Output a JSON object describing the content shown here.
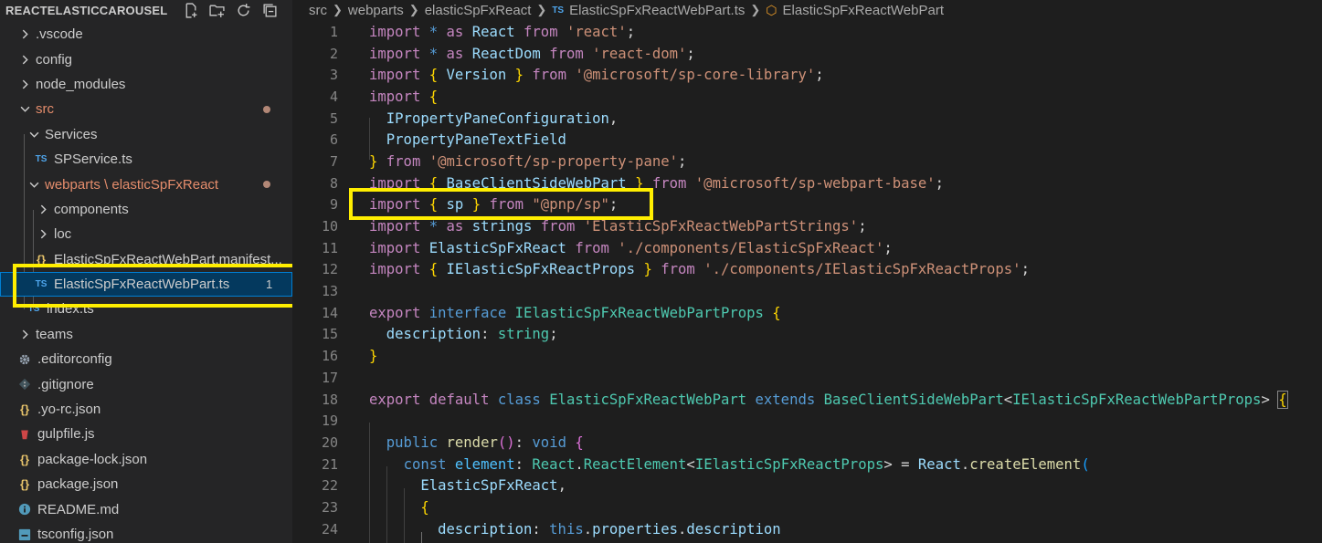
{
  "sidebar": {
    "title": "REACTELASTICCAROUSEL",
    "actions": [
      "new-file-icon",
      "new-folder-icon",
      "refresh-icon",
      "collapse-all-icon"
    ],
    "items": [
      {
        "label": ".vscode",
        "kind": "folder",
        "depth": 0,
        "open": false
      },
      {
        "label": "config",
        "kind": "folder",
        "depth": 0,
        "open": false
      },
      {
        "label": "node_modules",
        "kind": "folder",
        "depth": 0,
        "open": false
      },
      {
        "label": "src",
        "kind": "folder",
        "depth": 0,
        "open": true,
        "modified": true
      },
      {
        "label": "Services",
        "kind": "folder",
        "depth": 1,
        "open": true
      },
      {
        "label": "SPService.ts",
        "kind": "ts",
        "depth": 1
      },
      {
        "label": "webparts \\ elasticSpFxReact",
        "kind": "folder",
        "depth": 1,
        "open": true,
        "modified": true
      },
      {
        "label": "components",
        "kind": "folder",
        "depth": 2,
        "open": false
      },
      {
        "label": "loc",
        "kind": "folder",
        "depth": 2,
        "open": false
      },
      {
        "label": "ElasticSpFxReactWebPart.manifest...",
        "kind": "json",
        "depth": 2
      },
      {
        "label": "ElasticSpFxReactWebPart.ts",
        "kind": "ts",
        "depth": 2,
        "selected": true,
        "badge": "1"
      },
      {
        "label": "index.ts",
        "kind": "ts",
        "depth": 1
      },
      {
        "label": "teams",
        "kind": "folder",
        "depth": 0,
        "open": false
      },
      {
        "label": ".editorconfig",
        "kind": "gear",
        "depth": 0
      },
      {
        "label": ".gitignore",
        "kind": "git",
        "depth": 0
      },
      {
        "label": ".yo-rc.json",
        "kind": "json",
        "depth": 0
      },
      {
        "label": "gulpfile.js",
        "kind": "gulp",
        "depth": 0
      },
      {
        "label": "package-lock.json",
        "kind": "json",
        "depth": 0
      },
      {
        "label": "package.json",
        "kind": "json",
        "depth": 0
      },
      {
        "label": "README.md",
        "kind": "info",
        "depth": 0
      },
      {
        "label": "tsconfig.json",
        "kind": "tsconfig",
        "depth": 0
      }
    ]
  },
  "breadcrumb": {
    "parts": [
      "src",
      "webparts",
      "elasticSpFxReact",
      "ElasticSpFxReactWebPart.ts",
      "ElasticSpFxReactWebPart"
    ],
    "file_icon": "TS"
  },
  "editor": {
    "line_numbers": [
      "1",
      "2",
      "3",
      "4",
      "5",
      "6",
      "7",
      "8",
      "9",
      "10",
      "11",
      "12",
      "13",
      "14",
      "15",
      "16",
      "17",
      "18",
      "19",
      "20",
      "21",
      "22",
      "23",
      "24"
    ],
    "lines": [
      "import * as React from 'react';",
      "import * as ReactDom from 'react-dom';",
      "import { Version } from '@microsoft/sp-core-library';",
      "import {",
      "  IPropertyPaneConfiguration,",
      "  PropertyPaneTextField",
      "} from '@microsoft/sp-property-pane';",
      "import { BaseClientSideWebPart } from '@microsoft/sp-webpart-base';",
      "import { sp } from \"@pnp/sp\";",
      "import * as strings from 'ElasticSpFxReactWebPartStrings';",
      "import ElasticSpFxReact from './components/ElasticSpFxReact';",
      "import { IElasticSpFxReactProps } from './components/IElasticSpFxReactProps';",
      "",
      "export interface IElasticSpFxReactWebPartProps {",
      "  description: string;",
      "}",
      "",
      "export default class ElasticSpFxReactWebPart extends BaseClientSideWebPart<IElasticSpFxReactWebPartProps> {",
      "",
      "  public render(): void {",
      "    const element: React.ReactElement<IElasticSpFxReactProps> = React.createElement(",
      "      ElasticSpFxReact,",
      "      {",
      "        description: this.properties.description"
    ]
  },
  "colors": {
    "highlight": "#ffee00",
    "selection": "#04395e",
    "keyword": "#569cd6",
    "control": "#c586c0",
    "string": "#ce9178",
    "type": "#4ec9b0"
  }
}
